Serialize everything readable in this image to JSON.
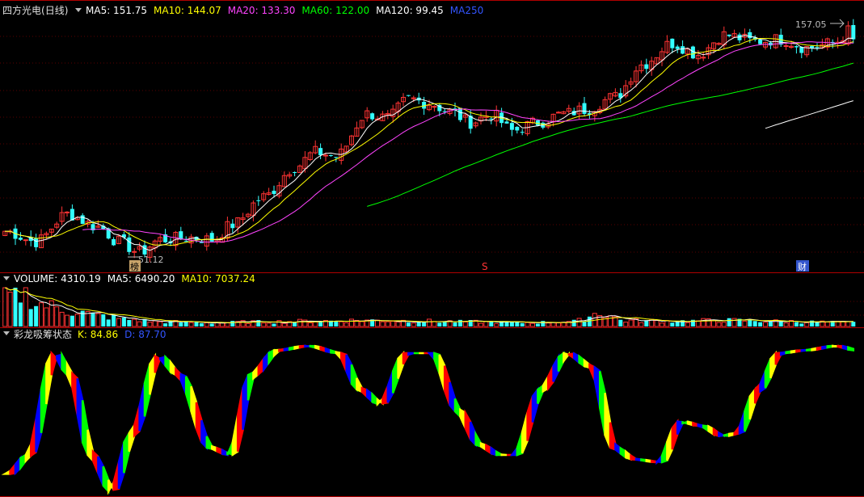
{
  "price_panel": {
    "name": "四方光电",
    "period": "(日线)",
    "legend": [
      {
        "text": "MA5: 151.75",
        "color": "#ffffff"
      },
      {
        "text": "MA10: 144.07",
        "color": "#ffff00"
      },
      {
        "text": "MA20: 133.30",
        "color": "#ff44ff"
      },
      {
        "text": "MA60: 122.00",
        "color": "#00ff00"
      },
      {
        "text": "MA120: 99.45",
        "color": "#ffffff"
      },
      {
        "text": "MA250",
        "color": "#3355ff"
      }
    ],
    "high_label": "157.05",
    "low_label": "51.12",
    "markers": [
      "榜",
      "S",
      "财"
    ]
  },
  "volume_panel": {
    "legend": [
      {
        "text": "VOLUME: 4310.19",
        "color": "#ffffff"
      },
      {
        "text": "MA5: 6490.20",
        "color": "#ffffff"
      },
      {
        "text": "MA10: 7037.24",
        "color": "#ffff00"
      }
    ]
  },
  "indicator_panel": {
    "name": "彩龙吸筹状态",
    "legend": [
      {
        "text": "K: 84.86",
        "color": "#ffff00"
      },
      {
        "text": "D: 87.70",
        "color": "#3355ff"
      }
    ]
  },
  "chart_data": {
    "type": "candlestick",
    "title": "四方光电 (日线)",
    "price_range": [
      51.12,
      157.05
    ],
    "close_points": [
      [
        0,
        62
      ],
      [
        6,
        57
      ],
      [
        12,
        70
      ],
      [
        18,
        64
      ],
      [
        22,
        57
      ],
      [
        26,
        52
      ],
      [
        30,
        58
      ],
      [
        36,
        59
      ],
      [
        40,
        58
      ],
      [
        44,
        65
      ],
      [
        50,
        78
      ],
      [
        56,
        92
      ],
      [
        60,
        99
      ],
      [
        64,
        97
      ],
      [
        70,
        117
      ],
      [
        74,
        115
      ],
      [
        78,
        124
      ],
      [
        82,
        122
      ],
      [
        86,
        118
      ],
      [
        90,
        113
      ],
      [
        94,
        117
      ],
      [
        98,
        109
      ],
      [
        103,
        113
      ],
      [
        108,
        117
      ],
      [
        112,
        119
      ],
      [
        118,
        125
      ],
      [
        123,
        140
      ],
      [
        129,
        150
      ],
      [
        134,
        145
      ],
      [
        139,
        154
      ],
      [
        145,
        151
      ],
      [
        150,
        152
      ],
      [
        155,
        148
      ],
      [
        160,
        150
      ],
      [
        164,
        157
      ]
    ],
    "volume_shape": [
      [
        0,
        0.75
      ],
      [
        2,
        0.8
      ],
      [
        4,
        0.85
      ],
      [
        6,
        0.6
      ],
      [
        8,
        0.55
      ],
      [
        10,
        0.48
      ],
      [
        12,
        0.4
      ],
      [
        14,
        0.38
      ],
      [
        18,
        0.28
      ],
      [
        24,
        0.18
      ],
      [
        30,
        0.12
      ],
      [
        40,
        0.1
      ],
      [
        50,
        0.12
      ],
      [
        60,
        0.14
      ],
      [
        70,
        0.16
      ],
      [
        80,
        0.14
      ],
      [
        90,
        0.12
      ],
      [
        100,
        0.1
      ],
      [
        110,
        0.13
      ],
      [
        115,
        0.35
      ],
      [
        120,
        0.15
      ],
      [
        130,
        0.14
      ],
      [
        140,
        0.16
      ],
      [
        150,
        0.13
      ],
      [
        164,
        0.1
      ]
    ],
    "kd_shape": [
      [
        0,
        0.12
      ],
      [
        4,
        0.25
      ],
      [
        9,
        0.95
      ],
      [
        12,
        0.8
      ],
      [
        16,
        0.25
      ],
      [
        20,
        0.0
      ],
      [
        24,
        0.4
      ],
      [
        29,
        0.93
      ],
      [
        33,
        0.8
      ],
      [
        39,
        0.3
      ],
      [
        43,
        0.25
      ],
      [
        47,
        0.8
      ],
      [
        52,
        0.97
      ],
      [
        58,
        1.0
      ],
      [
        64,
        0.95
      ],
      [
        68,
        0.7
      ],
      [
        72,
        0.6
      ],
      [
        77,
        0.95
      ],
      [
        82,
        0.95
      ],
      [
        87,
        0.55
      ],
      [
        91,
        0.32
      ],
      [
        95,
        0.25
      ],
      [
        98,
        0.25
      ],
      [
        103,
        0.7
      ],
      [
        108,
        0.95
      ],
      [
        113,
        0.85
      ],
      [
        117,
        0.3
      ],
      [
        121,
        0.22
      ],
      [
        126,
        0.2
      ],
      [
        130,
        0.48
      ],
      [
        134,
        0.45
      ],
      [
        138,
        0.38
      ],
      [
        141,
        0.4
      ],
      [
        145,
        0.7
      ],
      [
        149,
        0.95
      ],
      [
        154,
        0.97
      ],
      [
        160,
        1.0
      ],
      [
        164,
        0.97
      ]
    ],
    "series": [
      {
        "name": "MA5",
        "values": [
          151.75
        ]
      },
      {
        "name": "MA10",
        "values": [
          144.07
        ]
      },
      {
        "name": "MA20",
        "values": [
          133.3
        ]
      },
      {
        "name": "MA60",
        "values": [
          122.0
        ]
      },
      {
        "name": "MA120",
        "values": [
          99.45
        ]
      },
      {
        "name": "VOLUME",
        "values": [
          4310.19
        ]
      },
      {
        "name": "K",
        "values": [
          84.86
        ]
      },
      {
        "name": "D",
        "values": [
          87.7
        ]
      }
    ],
    "colors": {
      "up": "#ff3333",
      "down": "#33ffff",
      "ma5": "#ffffff",
      "ma10": "#ffff00",
      "ma20": "#ff44ff",
      "ma60": "#00ff00",
      "ma120": "#ffffff",
      "kd": [
        "#ffff00",
        "#ff0000",
        "#0000ff",
        "#00ff00"
      ]
    }
  }
}
